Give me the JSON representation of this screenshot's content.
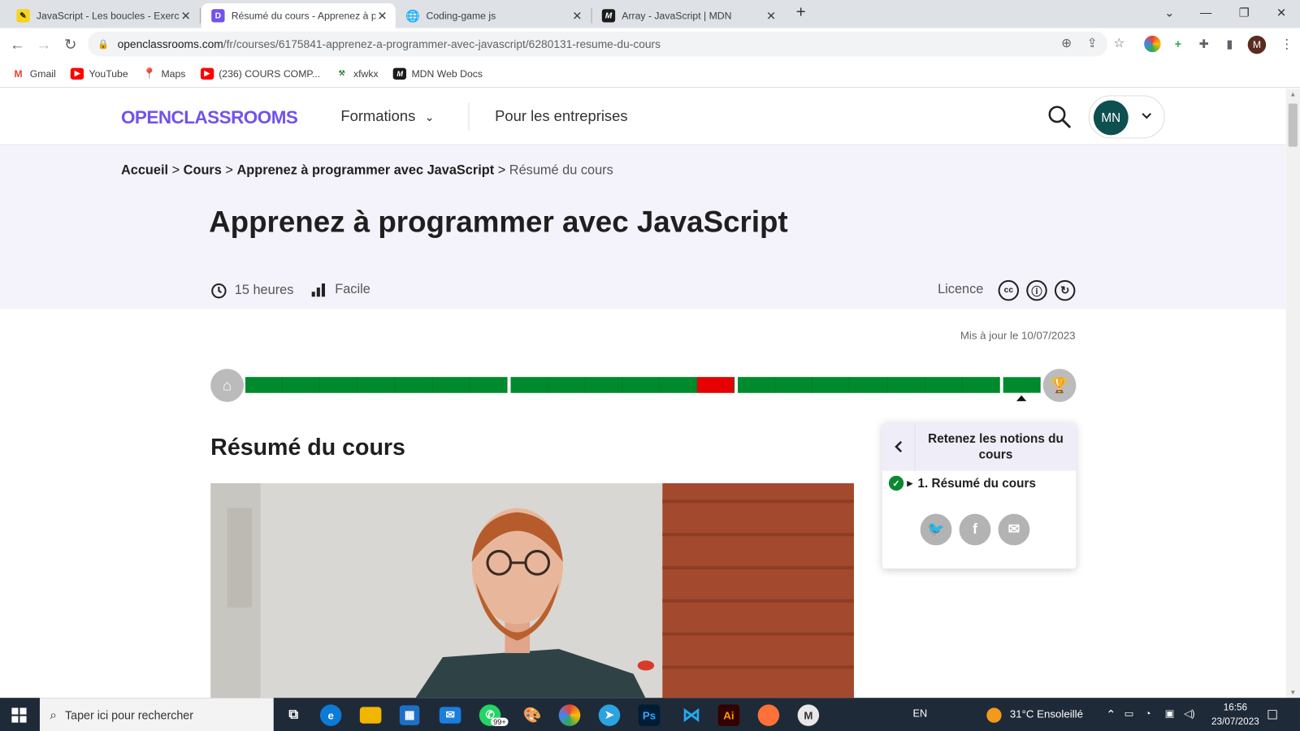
{
  "browser": {
    "tabs": [
      {
        "title": "JavaScript - Les boucles - Exercice",
        "favicon": "yellow-pen-icon"
      },
      {
        "title": "Résumé du cours - Apprenez à p",
        "favicon": "openclassrooms-icon"
      },
      {
        "title": "Coding-game js",
        "favicon": "globe-icon"
      },
      {
        "title": "Array - JavaScript | MDN",
        "favicon": "mdn-icon"
      }
    ],
    "url_host": "openclassrooms.com",
    "url_path": "/fr/courses/6175841-apprenez-a-programmer-avec-javascript/6280131-resume-du-cours",
    "profile_initial": "M",
    "bookmarks": [
      {
        "label": "Gmail",
        "icon": "gmail-icon"
      },
      {
        "label": "YouTube",
        "icon": "youtube-icon"
      },
      {
        "label": "Maps",
        "icon": "maps-icon"
      },
      {
        "label": "(236) COURS COMP...",
        "icon": "youtube-icon"
      },
      {
        "label": "xfwkx",
        "icon": "tool-icon"
      },
      {
        "label": "MDN Web Docs",
        "icon": "mdn-icon"
      }
    ]
  },
  "site": {
    "logo": "OPENCLASSROOMS",
    "nav_formations": "Formations",
    "nav_entreprises": "Pour les entreprises",
    "user_initials": "MN",
    "brand_color": "#7451eb"
  },
  "course": {
    "breadcrumb": [
      "Accueil",
      "Cours",
      "Apprenez à programmer avec JavaScript",
      "Résumé du cours"
    ],
    "breadcrumb_sep": ">",
    "title": "Apprenez à programmer avec JavaScript",
    "duration": "15 heures",
    "level": "Facile",
    "licence_label": "Licence",
    "updated": "Mis à jour le 10/07/2023",
    "section_title": "Résumé du cours"
  },
  "progress": {
    "parts": [
      {
        "chapters": 7,
        "failed": []
      },
      {
        "chapters": 6,
        "failed": [
          5
        ]
      },
      {
        "chapters": 7,
        "failed": []
      },
      {
        "chapters": 1,
        "failed": []
      }
    ],
    "completed_color": "#008a2e",
    "failed_color": "#e60000"
  },
  "sidebar": {
    "title": "Retenez les notions du cours",
    "items": [
      {
        "label": "1. Résumé du cours",
        "done": true
      }
    ],
    "share": [
      "twitter-icon",
      "facebook-icon",
      "email-icon"
    ]
  },
  "taskbar": {
    "search_placeholder": "Taper ici pour rechercher",
    "badge": "99+",
    "lang": "EN",
    "weather": "31°C  Ensoleillé",
    "time": "16:56",
    "date": "23/07/2023"
  }
}
